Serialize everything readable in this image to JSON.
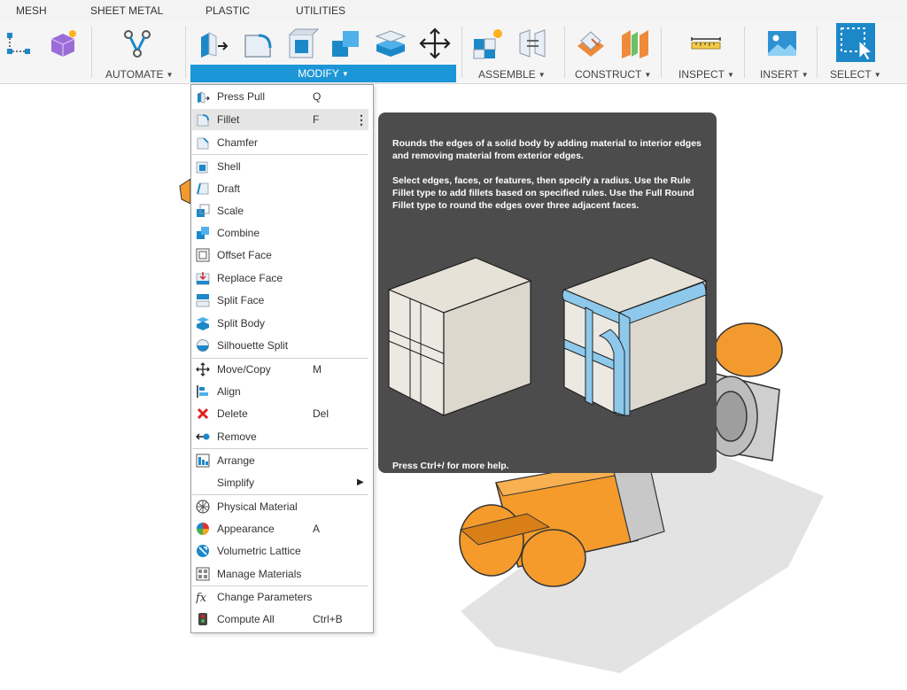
{
  "tabs": [
    "MESH",
    "SHEET METAL",
    "PLASTIC",
    "UTILITIES"
  ],
  "ribbon": {
    "groups": {
      "automate": "AUTOMATE",
      "modify": "MODIFY",
      "assemble": "ASSEMBLE",
      "construct": "CONSTRUCT",
      "inspect": "INSPECT",
      "insert": "INSERT",
      "select": "SELECT"
    },
    "accent_color": "#1c96d6"
  },
  "menu": {
    "items": [
      {
        "label": "Press Pull",
        "shortcut": "Q",
        "icon": "press-pull-icon"
      },
      {
        "label": "Fillet",
        "shortcut": "F",
        "icon": "fillet-icon",
        "highlighted": true
      },
      {
        "label": "Chamfer",
        "icon": "chamfer-icon"
      },
      {
        "label": "Shell",
        "icon": "shell-icon"
      },
      {
        "label": "Draft",
        "icon": "draft-icon"
      },
      {
        "label": "Scale",
        "icon": "scale-icon"
      },
      {
        "label": "Combine",
        "icon": "combine-icon"
      },
      {
        "label": "Offset Face",
        "icon": "offset-face-icon"
      },
      {
        "label": "Replace Face",
        "icon": "replace-face-icon"
      },
      {
        "label": "Split Face",
        "icon": "split-face-icon"
      },
      {
        "label": "Split Body",
        "icon": "split-body-icon"
      },
      {
        "label": "Silhouette Split",
        "icon": "silhouette-split-icon"
      },
      {
        "label": "Move/Copy",
        "shortcut": "M",
        "icon": "move-icon"
      },
      {
        "label": "Align",
        "icon": "align-icon"
      },
      {
        "label": "Delete",
        "shortcut": "Del",
        "icon": "delete-icon"
      },
      {
        "label": "Remove",
        "icon": "remove-icon"
      },
      {
        "label": "Arrange",
        "icon": "arrange-icon"
      },
      {
        "label": "Simplify",
        "icon": "simplify-icon"
      },
      {
        "label": "Physical Material",
        "icon": "physical-material-icon"
      },
      {
        "label": "Appearance",
        "shortcut": "A",
        "icon": "appearance-icon"
      },
      {
        "label": "Volumetric Lattice",
        "icon": "volumetric-lattice-icon"
      },
      {
        "label": "Manage Materials",
        "icon": "manage-materials-icon"
      },
      {
        "label": "Change Parameters",
        "icon": "change-parameters-icon"
      },
      {
        "label": "Compute All",
        "shortcut": "Ctrl+B",
        "icon": "compute-all-icon"
      }
    ]
  },
  "tooltip": {
    "para1": "Rounds the edges of a solid body by adding material to interior edges and removing material from exterior edges.",
    "para2": "Select edges, faces, or features, then specify a radius. Use the Rule Fillet type to add fillets based on specified rules. Use the Full Round Fillet type to round the edges over three adjacent faces.",
    "footer": "Press Ctrl+/ for more help."
  }
}
